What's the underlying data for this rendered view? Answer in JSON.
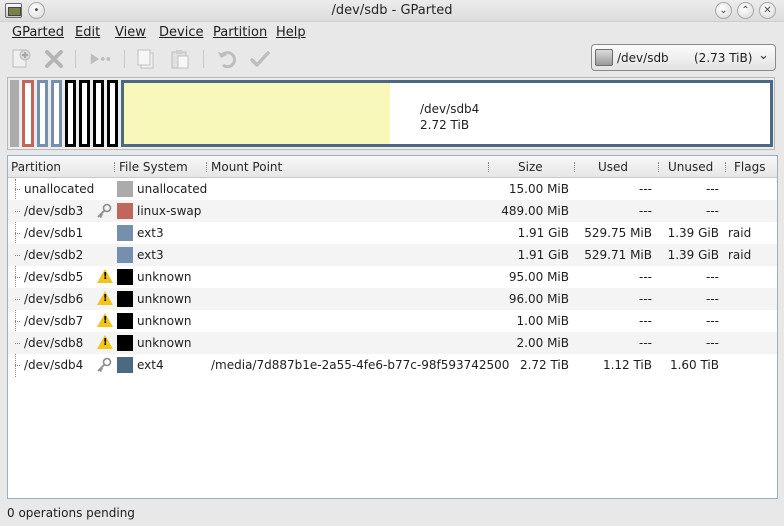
{
  "window": {
    "title": "/dev/sdb - GParted"
  },
  "menu": [
    {
      "label": "GParted"
    },
    {
      "label": "Edit"
    },
    {
      "label": "View"
    },
    {
      "label": "Device"
    },
    {
      "label": "Partition"
    },
    {
      "label": "Help"
    }
  ],
  "toolbar": {
    "buttons": [
      "new-icon",
      "delete-icon",
      "resize-move-icon",
      "copy-icon",
      "paste-icon",
      "undo-icon",
      "apply-icon"
    ]
  },
  "device": {
    "name": "/dev/sdb",
    "size": "(2.73 TiB)"
  },
  "diskmap": {
    "label_name": "/dev/sdb4",
    "label_size": "2.72 TiB"
  },
  "table": {
    "headers": {
      "partition": "Partition",
      "filesystem": "File System",
      "mount": "Mount Point",
      "size": "Size",
      "used": "Used",
      "unused": "Unused",
      "flags": "Flags"
    },
    "rows": [
      {
        "partition": "unallocated",
        "icon": "",
        "fs_color": "#ababab",
        "filesystem": "unallocated",
        "mount": "",
        "size": "15.00 MiB",
        "used": "---",
        "unused": "---",
        "flags": ""
      },
      {
        "partition": "/dev/sdb3",
        "icon": "key-icon",
        "fs_color": "#c1665a",
        "filesystem": "linux-swap",
        "mount": "",
        "size": "489.00 MiB",
        "used": "---",
        "unused": "---",
        "flags": ""
      },
      {
        "partition": "/dev/sdb1",
        "icon": "",
        "fs_color": "#7590ae",
        "filesystem": "ext3",
        "mount": "",
        "size": "1.91 GiB",
        "used": "529.75 MiB",
        "unused": "1.39 GiB",
        "flags": "raid"
      },
      {
        "partition": "/dev/sdb2",
        "icon": "",
        "fs_color": "#7590ae",
        "filesystem": "ext3",
        "mount": "",
        "size": "1.91 GiB",
        "used": "529.71 MiB",
        "unused": "1.39 GiB",
        "flags": "raid"
      },
      {
        "partition": "/dev/sdb5",
        "icon": "warning-icon",
        "fs_color": "#000000",
        "filesystem": "unknown",
        "mount": "",
        "size": "95.00 MiB",
        "used": "---",
        "unused": "---",
        "flags": ""
      },
      {
        "partition": "/dev/sdb6",
        "icon": "warning-icon",
        "fs_color": "#000000",
        "filesystem": "unknown",
        "mount": "",
        "size": "96.00 MiB",
        "used": "---",
        "unused": "---",
        "flags": ""
      },
      {
        "partition": "/dev/sdb7",
        "icon": "warning-icon",
        "fs_color": "#000000",
        "filesystem": "unknown",
        "mount": "",
        "size": "1.00 MiB",
        "used": "---",
        "unused": "---",
        "flags": ""
      },
      {
        "partition": "/dev/sdb8",
        "icon": "warning-icon",
        "fs_color": "#000000",
        "filesystem": "unknown",
        "mount": "",
        "size": "2.00 MiB",
        "used": "---",
        "unused": "---",
        "flags": ""
      },
      {
        "partition": "/dev/sdb4",
        "icon": "key-icon",
        "fs_color": "#4b6983",
        "filesystem": "ext4",
        "mount": "/media/7d887b1e-2a55-4fe6-b77c-98f593742500",
        "size": "2.72 TiB",
        "used": "1.12 TiB",
        "unused": "1.60 TiB",
        "flags": ""
      }
    ]
  },
  "status": {
    "text": "0 operations pending"
  }
}
